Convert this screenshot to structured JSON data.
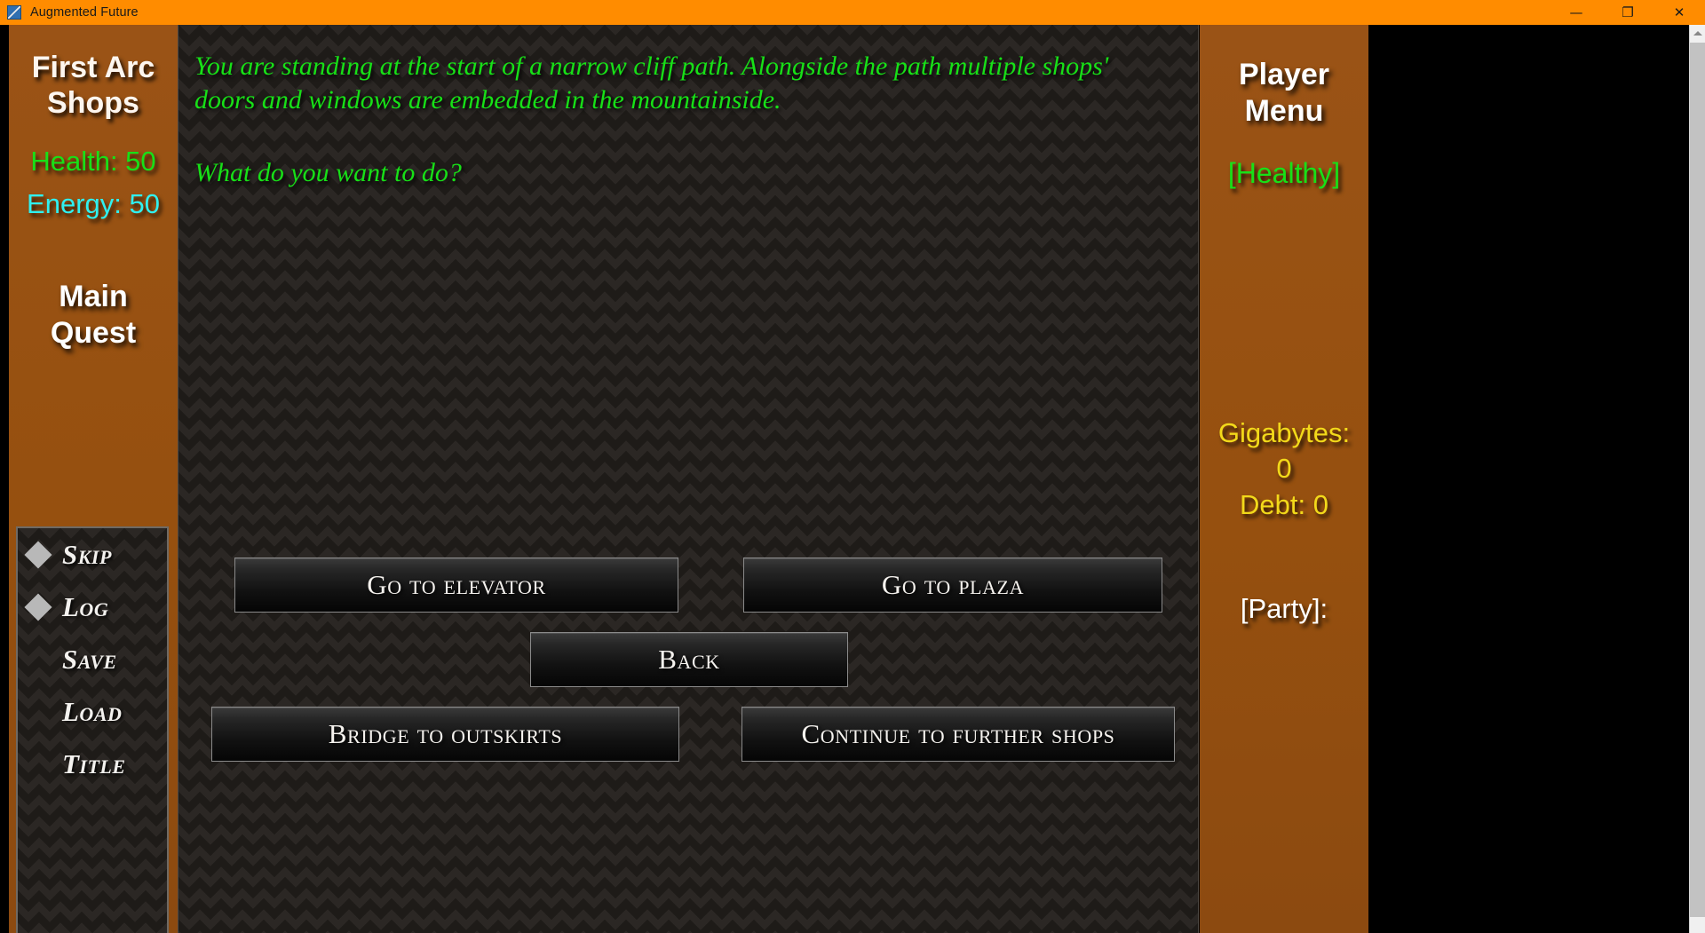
{
  "window": {
    "title": "Augmented Future",
    "icon": "app-icon",
    "controls": {
      "minimize": "—",
      "maximize": "❐",
      "close": "✕"
    }
  },
  "scrollbar": {
    "up_arrow": "scroll-up-arrow"
  },
  "left_sidebar": {
    "location_title_line1": "First Arc",
    "location_title_line2": "Shops",
    "health": "Health: 50",
    "energy": "Energy: 50",
    "quest_line1": "Main",
    "quest_line2": "Quest",
    "quick_menu": [
      {
        "label": "Skip",
        "bullet": true
      },
      {
        "label": "Log",
        "bullet": true
      },
      {
        "label": "Save",
        "bullet": false
      },
      {
        "label": "Load",
        "bullet": false
      },
      {
        "label": "Title",
        "bullet": false
      }
    ]
  },
  "story": {
    "paragraph": "You are standing at the start of a narrow cliff path. Alongside the path multiple shops' doors and windows are embedded in the mountainside.",
    "prompt": "What do you want to do?"
  },
  "choices": [
    {
      "id": "go-to-elevator",
      "label": "Go to elevator"
    },
    {
      "id": "go-to-plaza",
      "label": "Go to plaza"
    },
    {
      "id": "back",
      "label": "Back"
    },
    {
      "id": "bridge-to-outskirts",
      "label": "Bridge to outskirts"
    },
    {
      "id": "continue-to-further-shops",
      "label": "Continue to further shops"
    }
  ],
  "right_sidebar": {
    "menu_title_line1": "Player",
    "menu_title_line2": "Menu",
    "status": "[Healthy]",
    "gigabytes_label": "Gigabytes:",
    "gigabytes_value": "0",
    "debt": "Debt: 0",
    "party": "[Party]:"
  },
  "colors": {
    "titlebar": "#ff8c00",
    "sidebar_brown": "#96500f",
    "story_green": "#17e017",
    "health_green": "#18e018",
    "energy_cyan": "#2ff0f0",
    "money_yellow": "#f2d91a",
    "panel_dark": "#1e1b18"
  }
}
